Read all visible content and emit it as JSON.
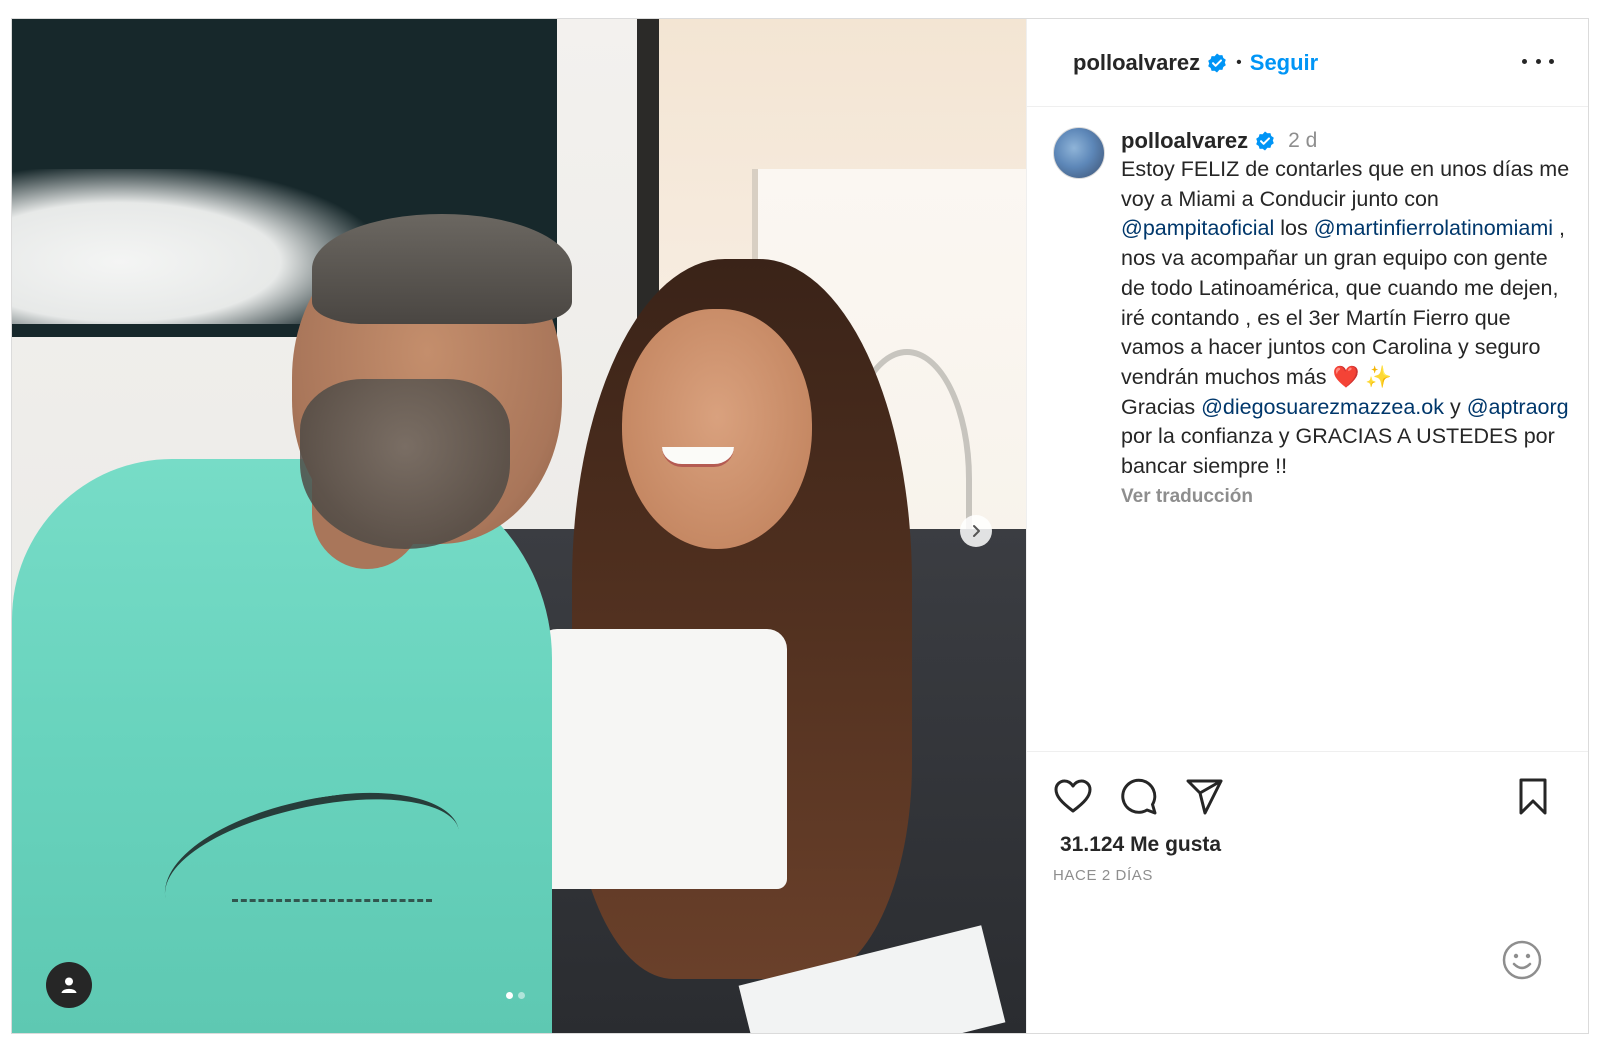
{
  "header": {
    "username": "polloalvarez",
    "separator": "•",
    "follow_label": "Seguir"
  },
  "caption": {
    "username": "polloalvarez",
    "time": "2 d",
    "text_1": "Estoy FELIZ de contarles que en unos días me voy a Miami a Conducir junto con ",
    "mention_1": "@pampitaoficial",
    "text_2": " los ",
    "mention_2": "@martinfierrolatinomiami",
    "text_3": " , nos va acompañar un gran equipo con gente de todo Latinoamérica, que cuando me dejen, iré contando , es el 3er Martín Fierro que vamos a hacer juntos con Carolina y seguro vendrán muchos más ",
    "emoji_heart": "❤️",
    "emoji_sparkles": "✨",
    "text_4": "Gracias ",
    "mention_3": "@diegosuarezmazzea.ok",
    "text_5": " y ",
    "mention_4": "@aptraorg",
    "text_6": " por la confianza y GRACIAS A USTEDES por bancar siempre !!",
    "translate_label": "Ver traducción"
  },
  "stats": {
    "likes": "31.124 Me gusta",
    "posted_ago": "HACE 2 DÍAS"
  },
  "carousel": {
    "current": 1,
    "total": 2
  },
  "icons": {
    "verified": "verified-badge-icon",
    "more": "more-options-icon",
    "like": "heart-icon",
    "comment": "comment-icon",
    "share": "share-icon",
    "save": "bookmark-icon",
    "emoji": "emoji-icon",
    "next": "chevron-right-icon",
    "tag": "user-tag-icon"
  },
  "colors": {
    "accent": "#0095f6",
    "mention": "#00376b",
    "muted": "#8e8e8e",
    "verified": "#0095f6"
  }
}
